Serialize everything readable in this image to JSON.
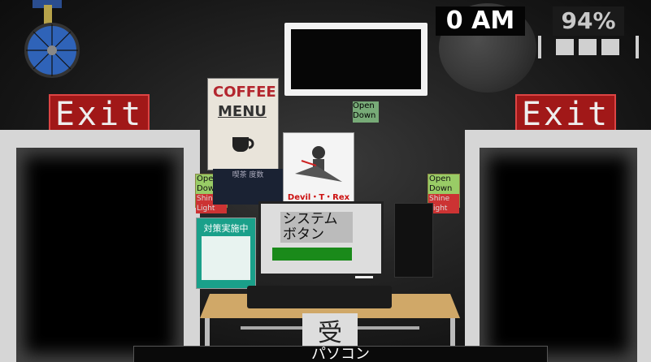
{
  "hud": {
    "time": "0 AM",
    "power_percent": "94%",
    "power_bars_filled": 3
  },
  "exits": {
    "left_label": "Exit",
    "right_label": "Exit"
  },
  "signs": {
    "open": "Open",
    "down": "Down",
    "shine": "Shine",
    "light": "Light"
  },
  "posters": {
    "coffee_title": "COFFEE",
    "coffee_menu": "MENU",
    "coffee_caption": "喫茶 度数",
    "devil_title": "Devil・T・Rex",
    "notice_title": "対策実施中"
  },
  "computer": {
    "screen_label": "システム ボタン",
    "desk_sign": "受",
    "bottom_label": "パソコン"
  },
  "colors": {
    "exit_bg": "#a11818",
    "monitor_button": "#1a8a1a"
  }
}
